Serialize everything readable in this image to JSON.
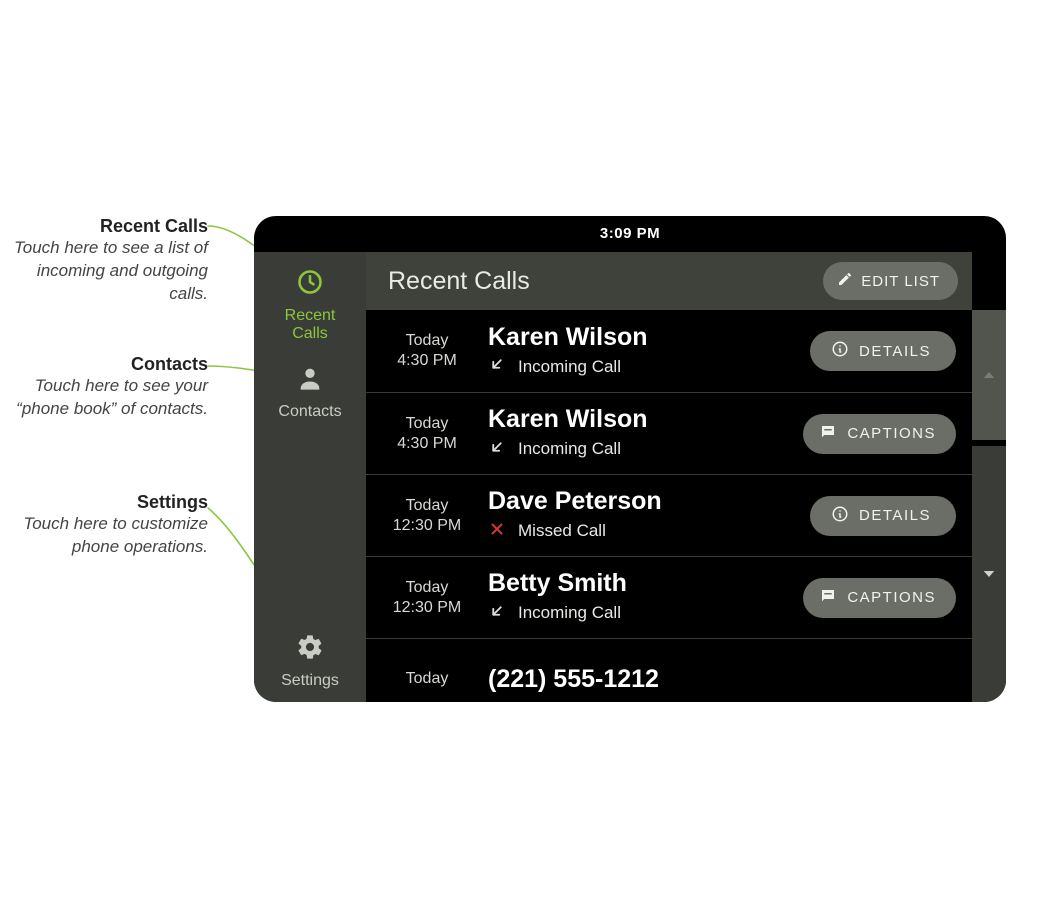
{
  "status": {
    "time": "3:09 PM"
  },
  "sidebar": {
    "recent": {
      "label": "Recent\nCalls"
    },
    "contacts": {
      "label": "Contacts"
    },
    "settings": {
      "label": "Settings"
    }
  },
  "header": {
    "title": "Recent Calls",
    "edit_label": "EDIT LIST"
  },
  "buttons": {
    "details": "DETAILS",
    "captions": "CAPTIONS"
  },
  "calls": [
    {
      "day": "Today",
      "time": "4:30 PM",
      "name": "Karen Wilson",
      "type": "incoming",
      "type_label": "Incoming Call",
      "action": "details"
    },
    {
      "day": "Today",
      "time": "4:30 PM",
      "name": "Karen Wilson",
      "type": "incoming",
      "type_label": "Incoming Call",
      "action": "captions"
    },
    {
      "day": "Today",
      "time": "12:30 PM",
      "name": "Dave Peterson",
      "type": "missed",
      "type_label": "Missed Call",
      "action": "details"
    },
    {
      "day": "Today",
      "time": "12:30 PM",
      "name": "Betty Smith",
      "type": "incoming",
      "type_label": "Incoming Call",
      "action": "captions"
    },
    {
      "day": "Today",
      "time": "",
      "name": "(221) 555-1212",
      "type": "incoming",
      "type_label": "",
      "action": ""
    }
  ],
  "annotations": {
    "recent": {
      "title": "Recent Calls",
      "desc": "Touch here to see a list of incoming and outgoing calls."
    },
    "contacts": {
      "title": "Contacts",
      "desc": "Touch here to see your “phone book” of contacts."
    },
    "settings": {
      "title": "Settings",
      "desc": "Touch here to customize phone operations."
    }
  }
}
